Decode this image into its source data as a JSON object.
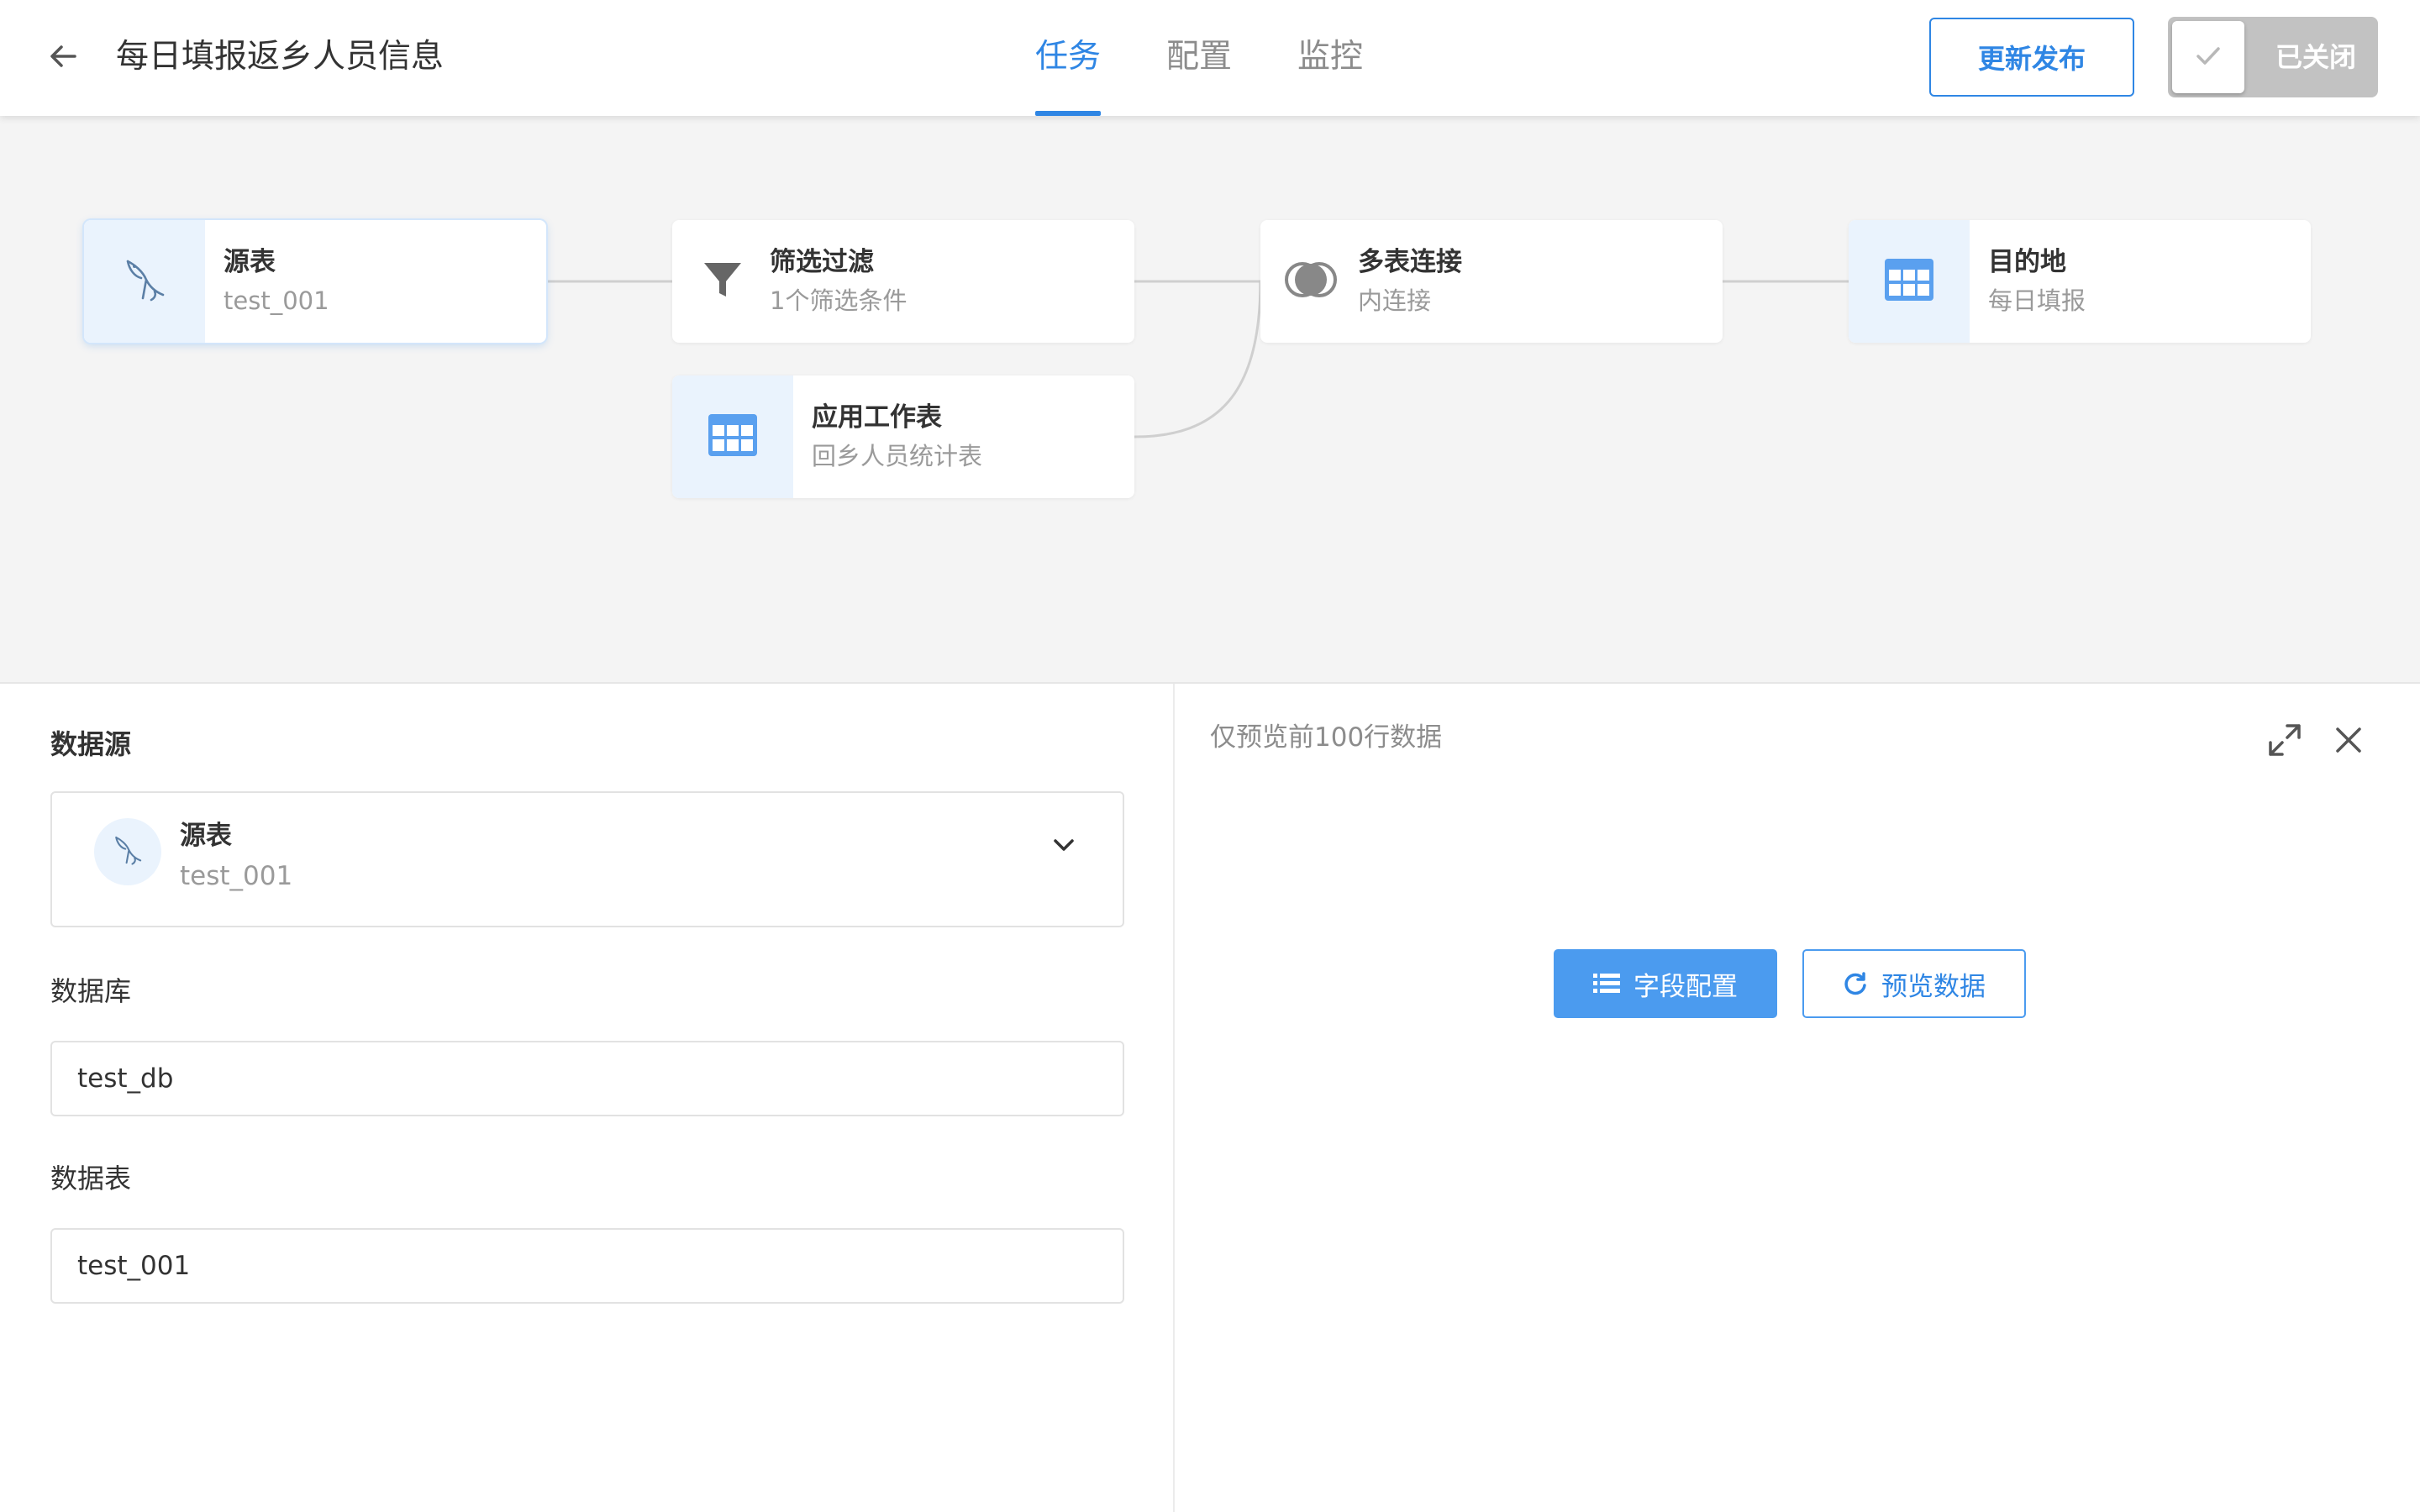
{
  "header": {
    "back_icon": "arrow-left-icon",
    "title": "每日填报返乡人员信息",
    "tabs": [
      {
        "label": "任务",
        "active": true
      },
      {
        "label": "配置",
        "active": false
      },
      {
        "label": "监控",
        "active": false
      }
    ],
    "publish_label": "更新发布",
    "toggle": {
      "label": "已关闭",
      "on": false,
      "icon": "check-icon"
    }
  },
  "flow": {
    "nodes": [
      {
        "title": "源表",
        "subtitle": "test_001",
        "icon": "mysql-dolphin-icon",
        "selected": true
      },
      {
        "title": "筛选过滤",
        "subtitle": "1个筛选条件",
        "icon": "filter-icon",
        "selected": false
      },
      {
        "title": "应用工作表",
        "subtitle": "回乡人员统计表",
        "icon": "table-grid-icon",
        "selected": false
      },
      {
        "title": "多表连接",
        "subtitle": "内连接",
        "icon": "join-circles-icon",
        "selected": false
      },
      {
        "title": "目的地",
        "subtitle": "每日填报",
        "icon": "table-grid-icon",
        "selected": false
      }
    ]
  },
  "config": {
    "datasource_label": "数据源",
    "datasource": {
      "title": "源表",
      "subtitle": "test_001",
      "icon": "mysql-dolphin-icon"
    },
    "database_label": "数据库",
    "database_value": "test_db",
    "table_label": "数据表",
    "table_value": "test_001"
  },
  "preview": {
    "hint": "仅预览前100行数据",
    "field_config_label": "字段配置",
    "preview_data_label": "预览数据"
  },
  "colors": {
    "accent": "#2f86e4",
    "primary_button": "#4b9bef",
    "canvas_bg": "#f4f4f4",
    "toggle_off": "#c2c2c2"
  }
}
